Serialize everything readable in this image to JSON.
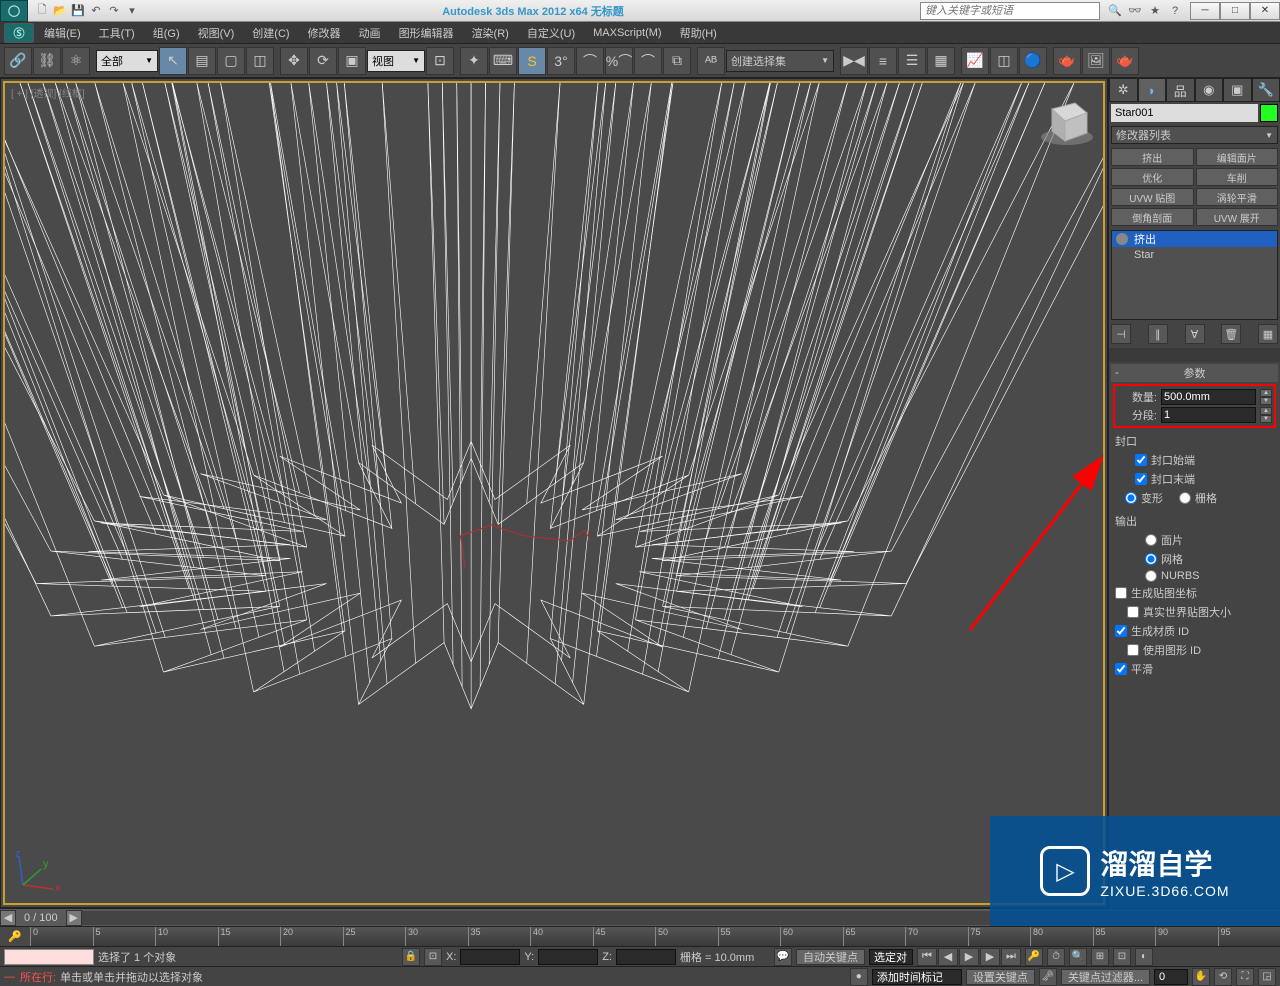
{
  "titlebar": {
    "title_text": "Autodesk 3ds Max 2012 x64    无标题",
    "search_placeholder": "键入关键字或短语"
  },
  "menu": {
    "edit": "编辑(E)",
    "tools": "工具(T)",
    "group": "组(G)",
    "views": "视图(V)",
    "create": "创建(C)",
    "modifiers": "修改器",
    "animation": "动画",
    "graph": "图形编辑器",
    "rendering": "渲染(R)",
    "customize": "自定义(U)",
    "maxscript": "MAXScript(M)",
    "help": "帮助(H)"
  },
  "toolbar": {
    "filter_all": "全部",
    "view_label": "视图",
    "named_sel": "创建选择集"
  },
  "viewport": {
    "label": "[ + ] [透视] [线框]"
  },
  "cmdpanel": {
    "object_name": "Star001",
    "modifier_list": "修改器列表",
    "mods": {
      "extrude": "挤出",
      "editmesh": "编辑面片",
      "optimize": "优化",
      "lathe": "车削",
      "uvwmap": "UVW 贴图",
      "turbosmooth": "涡轮平滑",
      "chamfer": "倒角剖面",
      "uvwunwrap": "UVW 展开"
    },
    "stack": {
      "item1": "挤出",
      "item2": "Star"
    },
    "rollout_params": "参数",
    "amount_label": "数量:",
    "amount_value": "500.0mm",
    "segments_label": "分段:",
    "segments_value": "1",
    "cap_group": "封口",
    "cap_start": "封口始端",
    "cap_end": "封口末端",
    "morph": "变形",
    "grid": "栅格",
    "output_group": "输出",
    "patch": "面片",
    "mesh": "网格",
    "nurbs": "NURBS",
    "gen_mapping": "生成贴图坐标",
    "real_world": "真实世界贴图大小",
    "gen_matid": "生成材质 ID",
    "use_shapeid": "使用图形 ID",
    "smooth": "平滑"
  },
  "timeline": {
    "frame_counter": "0 / 100"
  },
  "status": {
    "prompt1": "选择了 1 个对象",
    "prompt2": "单击或单击并拖动以选择对象",
    "x": "X:",
    "y": "Y:",
    "z": "Z:",
    "grid": "栅格 = 10.0mm",
    "autokey": "自动关键点",
    "selset": "选定对",
    "setkey": "设置关键点",
    "keyfilter": "关键点过滤器...",
    "addtime": "添加时间标记",
    "where_label": "所在行:"
  },
  "watermark": {
    "brand": "溜溜自学",
    "url": "ZIXUE.3D66.COM"
  }
}
